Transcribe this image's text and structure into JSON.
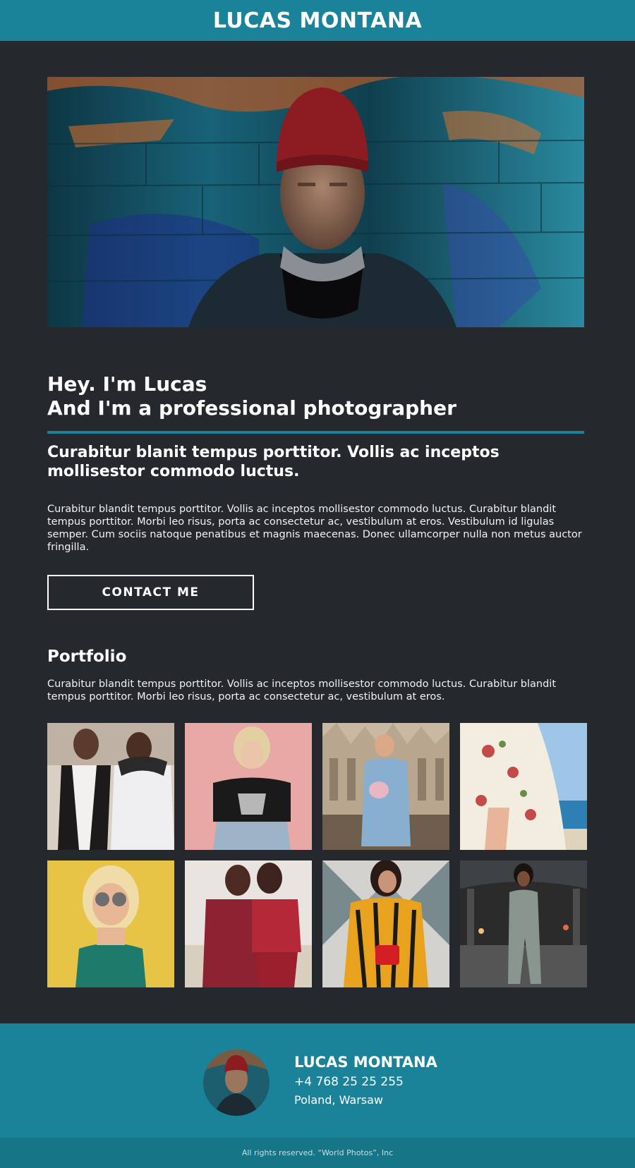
{
  "header": {
    "title": "LUCAS MONTANA"
  },
  "intro": {
    "title_line1": "Hey. I'm Lucas",
    "title_line2": "And I'm a professional photographer",
    "subheading": "Curabitur blanit tempus porttitor. Vollis ac inceptos mollisestor commodo luctus.",
    "text": "Curabitur blandit tempus porttitor. Vollis ac inceptos mollisestor commodo luctus. Curabitur blandit tempus porttitor. Morbi leo risus, porta ac consectetur ac, vestibulum at eros. Vestibulum id ligulas semper. Cum sociis natoque penatibus et magnis maecenas. Donec ullamcorper nulla non metus auctor fringilla.",
    "contact_label": "CONTACT ME"
  },
  "portfolio": {
    "title": "Portfolio",
    "text": "Curabitur blandit tempus porttitor. Vollis ac inceptos mollisestor commodo luctus. Curabitur blandit tempus porttitor. Morbi leo risus, porta ac consectetur ac, vestibulum at eros."
  },
  "footer": {
    "name": "LUCAS MONTANA",
    "phone": "+4 768 25 25 255",
    "location": "Poland, Warsaw",
    "copyright": "All rights reserved. “World Photos”, Inc"
  },
  "colors": {
    "accent": "#1a8399",
    "background": "#25282d",
    "copyright_bar": "#177588"
  }
}
